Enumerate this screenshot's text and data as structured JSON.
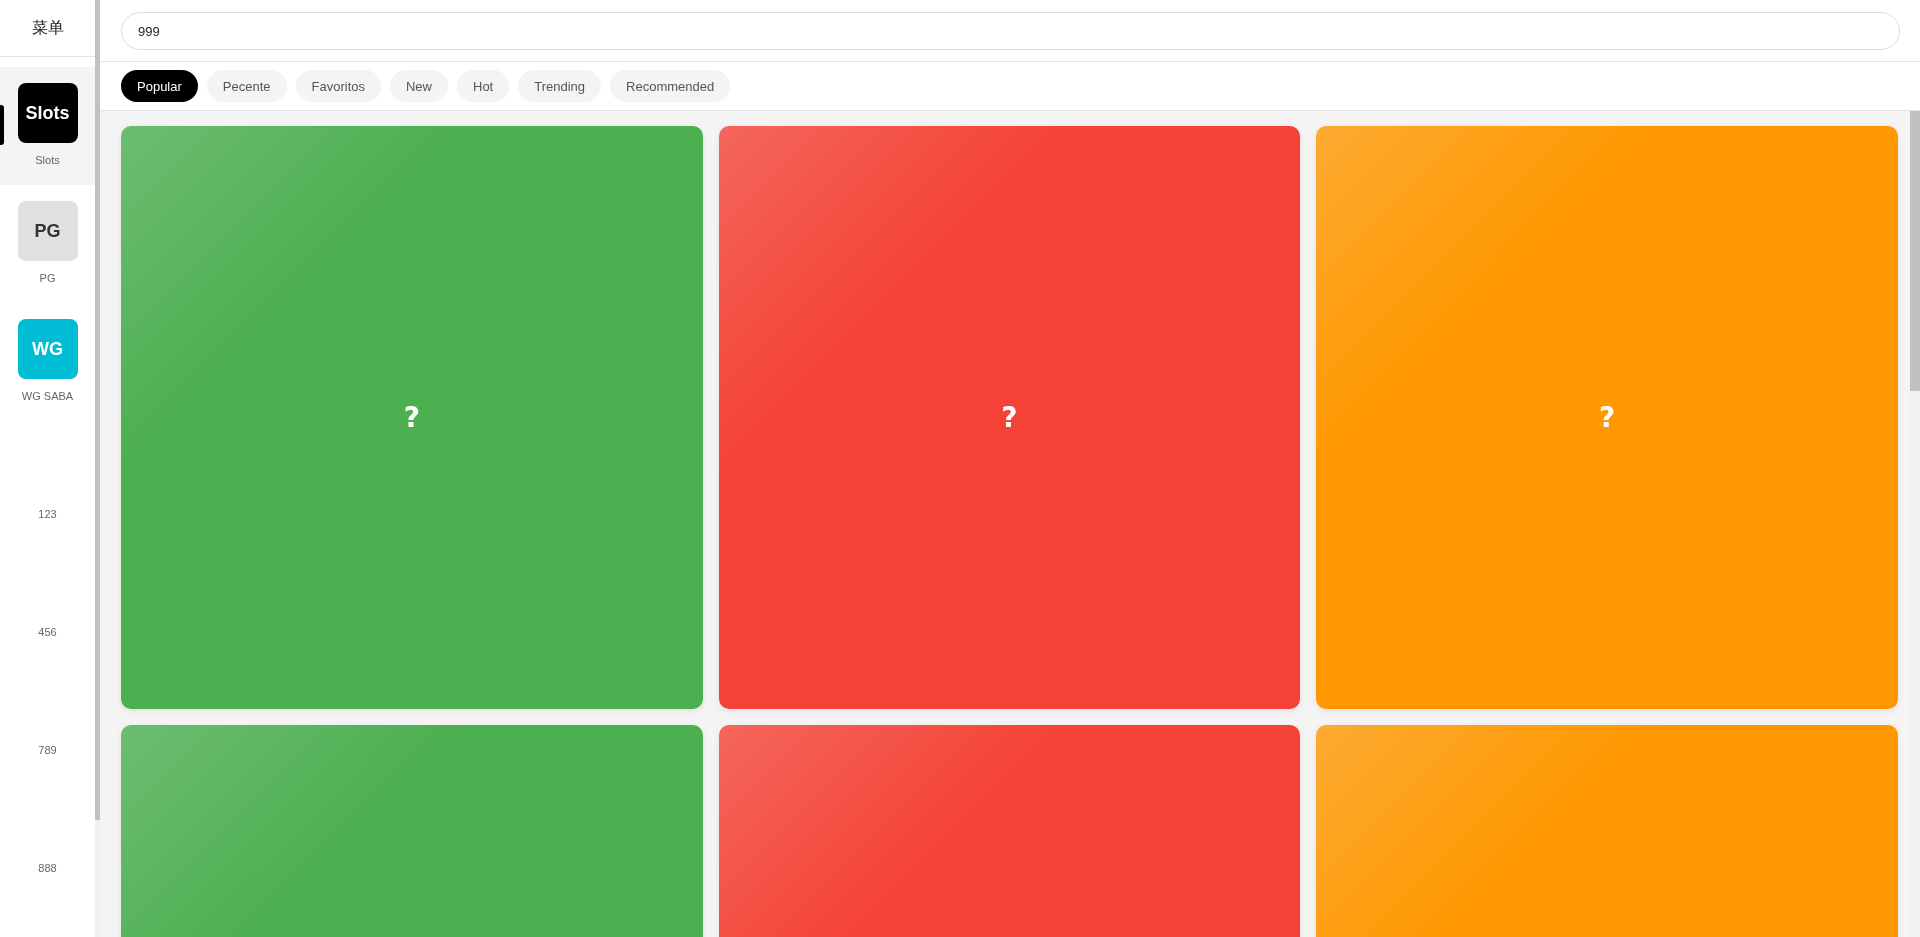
{
  "sidebar": {
    "title": "菜单",
    "items": [
      {
        "kind": "icon",
        "icon_text": "Slots",
        "label": "Slots",
        "color": "#000000",
        "selected": true
      },
      {
        "kind": "icon",
        "icon_text": "PG",
        "label": "PG",
        "color": "#e0e0e0",
        "selected": false
      },
      {
        "kind": "icon",
        "icon_text": "WG",
        "label": "WG SABA",
        "color": "#00bcd4",
        "selected": false
      },
      {
        "kind": "text",
        "label": "123",
        "selected": false
      },
      {
        "kind": "text",
        "label": "456",
        "selected": false
      },
      {
        "kind": "text",
        "label": "789",
        "selected": false
      },
      {
        "kind": "text",
        "label": "888",
        "selected": false
      }
    ]
  },
  "search": {
    "value": "999"
  },
  "tabs": [
    {
      "label": "Popular",
      "selected": true
    },
    {
      "label": "Pecente",
      "selected": false
    },
    {
      "label": "Favoritos",
      "selected": false
    },
    {
      "label": "New",
      "selected": false
    },
    {
      "label": "Hot",
      "selected": false
    },
    {
      "label": "Trending",
      "selected": false
    },
    {
      "label": "Recommended",
      "selected": false
    }
  ],
  "cards": [
    {
      "color": "#4caf50",
      "label": "?"
    },
    {
      "color": "#f44336",
      "label": "?"
    },
    {
      "color": "#ff9800",
      "label": "?"
    },
    {
      "color": "#4caf50"
    },
    {
      "color": "#f44336"
    },
    {
      "color": "#ff9800"
    }
  ]
}
